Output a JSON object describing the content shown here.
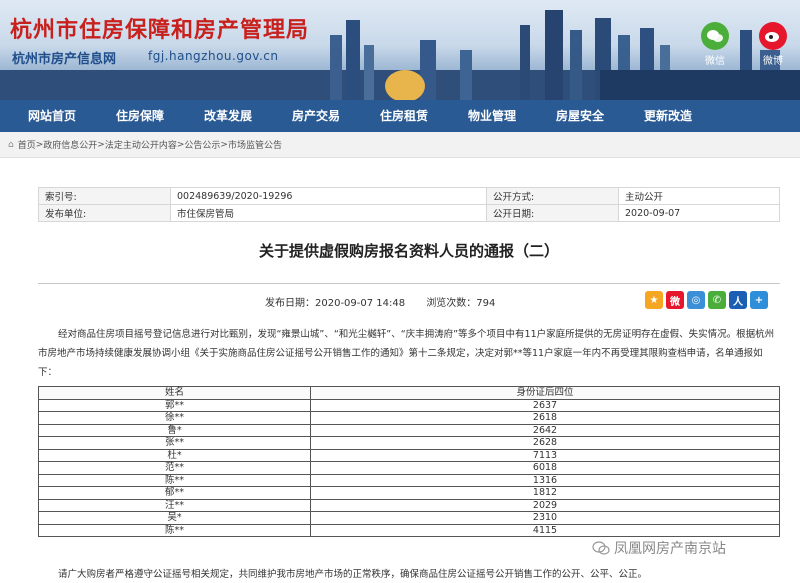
{
  "site": {
    "title": "杭州市住房保障和房产管理局",
    "subtitle": "杭州市房产信息网",
    "url": "fgj.hangzhou.gov.cn",
    "social": [
      {
        "label": "微信",
        "icon": "wechat-icon",
        "color": "#4cae3a"
      },
      {
        "label": "微博",
        "icon": "weibo-icon",
        "color": "#e6162d"
      }
    ]
  },
  "nav": {
    "items": [
      "网站首页",
      "住房保障",
      "改革发展",
      "房产交易",
      "住房租赁",
      "物业管理",
      "房屋安全",
      "更新改造"
    ]
  },
  "breadcrumb": {
    "items": [
      "首页",
      "政府信息公开",
      "法定主动公开内容",
      "公告公示",
      "市场监管公告"
    ],
    "separator": ">"
  },
  "meta": {
    "index_label": "索引号:",
    "index_value": "002489639/2020-19296",
    "public_method_label": "公开方式:",
    "public_method_value": "主动公开",
    "issuer_label": "发布单位:",
    "issuer_value": "市住保房管局",
    "public_date_label": "公开日期:",
    "public_date_value": "2020-09-07"
  },
  "article": {
    "title": "关于提供虚假购房报名资料人员的通报（二）",
    "publish_date_text": "发布日期：2020-09-07 14:48",
    "views_text": "浏览次数：794",
    "paragraph1": "经对商品住房项目摇号登记信息进行对比甄别，发现“雍景山城”、“和光尘樾轩”、“庆丰拥涛府”等多个项目中有11户家庭所提供的无房证明存在虚假、失实情况。根据杭州市房地产市场持续健康发展协调小组《关于实施商品住房公证摇号公开销售工作的通知》第十二条规定，决定对郭**等11户家庭一年内不再受理其限购查档申请，名单通报如下：",
    "paragraph2": "请广大购房者严格遵守公证摇号相关规定，共同维护我市房地产市场的正常秩序，确保商品住房公证摇号公开销售工作的公开、公平、公正。"
  },
  "share": [
    {
      "icon": "qzone-star-icon",
      "color": "#f5a623",
      "glyph": "★"
    },
    {
      "icon": "sina-weibo-icon",
      "color": "#e6162d",
      "glyph": "微"
    },
    {
      "icon": "tencent-weibo-icon",
      "color": "#3b8fd6",
      "glyph": "◎"
    },
    {
      "icon": "wechat-share-icon",
      "color": "#4cae3a",
      "glyph": "✆"
    },
    {
      "icon": "renren-icon",
      "color": "#1a5fb4",
      "glyph": "人"
    },
    {
      "icon": "more-share-icon",
      "color": "#2e8fd8",
      "glyph": "+"
    }
  ],
  "names_table": {
    "headers": [
      "姓名",
      "身份证后四位"
    ],
    "rows": [
      [
        "郭**",
        "2637"
      ],
      [
        "徐**",
        "2618"
      ],
      [
        "鲁*",
        "2642"
      ],
      [
        "张**",
        "2628"
      ],
      [
        "杜*",
        "7113"
      ],
      [
        "范**",
        "6018"
      ],
      [
        "陈**",
        "1316"
      ],
      [
        "郁**",
        "1812"
      ],
      [
        "汪**",
        "2029"
      ],
      [
        "吴*",
        "2310"
      ],
      [
        "陈**",
        "4115"
      ]
    ]
  },
  "watermark": {
    "text": "凤凰网房产南京站"
  }
}
